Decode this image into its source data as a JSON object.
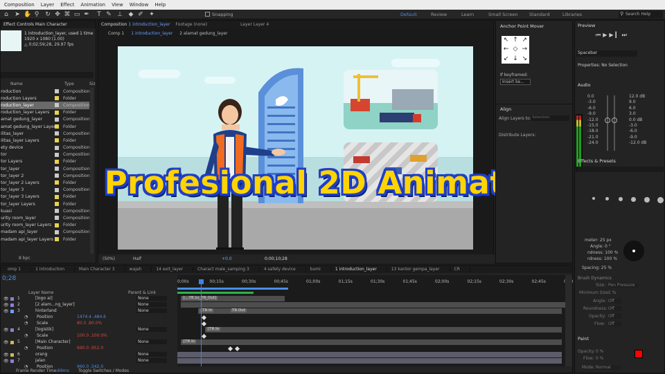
{
  "menu": [
    "Composition",
    "Layer",
    "Effect",
    "Animation",
    "View",
    "Window",
    "Help"
  ],
  "toolbar": {
    "snapping": "Snapping",
    "workspaces": [
      "Default",
      "Review",
      "Learn",
      "Small Screen",
      "Standard",
      "Libraries"
    ],
    "search": "Search Help"
  },
  "effect_controls": {
    "tab": "Effect Controls Main Character"
  },
  "project": {
    "comp_name": "1 introduction_layer",
    "used": ", used 1 time",
    "size": "1920 x 1080 (1.00)",
    "duration": "△ 0;02;59;28, 29.97 fps",
    "col_name": "Name",
    "col_type": "Type",
    "col_size": "Siz",
    "items": [
      {
        "name": "roduction",
        "type": "Composition",
        "color": "#c9c9c9"
      },
      {
        "name": "roduction Layers",
        "type": "Folder",
        "color": "#e8d24d"
      },
      {
        "name": "roduction_layer",
        "type": "Composition",
        "color": "#c9c9c9"
      },
      {
        "name": "roduction_layer Layers",
        "type": "Folder",
        "color": "#e8d24d"
      },
      {
        "name": "amat gedung_layer",
        "type": "Composition",
        "color": "#c9c9c9"
      },
      {
        "name": "amat gedung_layer Layers",
        "type": "Folder",
        "color": "#e8d24d"
      },
      {
        "name": "ilitas_layer",
        "type": "Composition",
        "color": "#c9c9c9"
      },
      {
        "name": "ilitas_layer Layers",
        "type": "Folder",
        "color": "#e8d24d"
      },
      {
        "name": "ety device",
        "type": "Composition",
        "color": "#c9c9c9"
      },
      {
        "name": "tor",
        "type": "Composition",
        "color": "#c9c9c9"
      },
      {
        "name": "tor Layers",
        "type": "Folder",
        "color": "#e8d24d"
      },
      {
        "name": "tor_layer",
        "type": "Composition",
        "color": "#c9c9c9"
      },
      {
        "name": "tor_layer 2",
        "type": "Composition",
        "color": "#c9c9c9"
      },
      {
        "name": "tor_layer 2 Layers",
        "type": "Folder",
        "color": "#e8d24d"
      },
      {
        "name": "tor_layer 3",
        "type": "Composition",
        "color": "#c9c9c9"
      },
      {
        "name": "tor_layer 3 Layers",
        "type": "Folder",
        "color": "#e8d24d"
      },
      {
        "name": "tor_layer Layers",
        "type": "Folder",
        "color": "#e8d24d"
      },
      {
        "name": "kuasi",
        "type": "Composition",
        "color": "#c9c9c9"
      },
      {
        "name": "urity room_layer",
        "type": "Composition",
        "color": "#c9c9c9"
      },
      {
        "name": "urity room_layer Layers",
        "type": "Folder",
        "color": "#e8d24d"
      },
      {
        "name": "madam api_layer",
        "type": "Composition",
        "color": "#c9c9c9"
      },
      {
        "name": "madam api_layer Layers",
        "type": "Folder",
        "color": "#e8d24d"
      }
    ],
    "bpc": "8 bpc"
  },
  "composition": {
    "tab_label": "Composition",
    "tab_name": "1 introduction_layer",
    "footage": "Footage (none)",
    "layer": "Layer Layer 4",
    "breadcrumbs": [
      "Comp 1",
      "1 introduction_layer",
      "2 alamat gedung_layer"
    ],
    "zoom": "(50%)",
    "resolution": "Half",
    "exposure": "+0.0",
    "timecode": "0;00;10;28"
  },
  "anchor_panel": {
    "title": "Anchor Point Mover",
    "if_keyframed": "If keyframed:",
    "insert": "Insert ke..."
  },
  "align_panel": {
    "title": "Align",
    "align_to": "Align Layers to:",
    "selection": "Selection",
    "distribute": "Distribute Layers:"
  },
  "preview": {
    "title": "Preview",
    "shortcut": "Spacebar",
    "properties": "Properties: No Selection"
  },
  "audio": {
    "title": "Audio",
    "left": [
      "0.0",
      "-3.0",
      "-6.0",
      "-9.0",
      "-12.0",
      "-15.0",
      "-18.0",
      "-21.0",
      "-24.0"
    ],
    "right": [
      "12.0 dB",
      "9.0",
      "6.0",
      "3.0",
      "0.0 dB",
      "-3.0",
      "-6.0",
      "-9.0",
      "-12.0 dB"
    ]
  },
  "effects": {
    "title": "Effects & Presets"
  },
  "brush": {
    "diameter": "meter: 25 px",
    "angle": "Angle: 0 °",
    "roundness": "ndness: 100 %",
    "hardness": "rdness: 100 %",
    "spacing": "Spacing: 25 %",
    "dynamics": "Brush Dynamics",
    "size": "Size:",
    "pressure": "Pen Pressure",
    "min_size": "Minimum Size:",
    "min_val": "1 %",
    "angle2": "Angle:",
    "roundness2": "Roundness:",
    "opacity": "Opacity:",
    "flow": "Flow:",
    "off": "Off"
  },
  "paint": {
    "title": "Paint",
    "opacity": "Opacity:",
    "opacity_val": "0 %",
    "flow": "Flow:",
    "flow_val": "0 %",
    "mode": "Mode:",
    "mode_val": "Normal",
    "fg": "#ff0000",
    "bg": "#ffffff"
  },
  "overlay_title": "Profesional 2D Animation",
  "timeline": {
    "tabs": [
      "omp 1",
      "1 introduction",
      "Main Character 3",
      "wajah",
      "14 exit_layer",
      "Charact male_samping 3",
      "4 safety device",
      "bumi",
      "1 introduction_layer",
      "13 kantor gempa_layer",
      "CR"
    ],
    "timecode": "0;28",
    "ruler": [
      "0;00s",
      "00;15s",
      "00;30s",
      "00;45s",
      "01;00s",
      "01;15s",
      "01;30s",
      "01;45s",
      "02;00s",
      "02;15s",
      "02;30s",
      "02;45s",
      "03;0"
    ],
    "col_layer": "Layer Name",
    "col_parent": "Parent & Link",
    "rows": [
      {
        "num": "1",
        "name": "[logo ai]",
        "parent": "None",
        "kind": "layer"
      },
      {
        "num": "2",
        "name": "[2 alam...ng_layer]",
        "parent": "None",
        "kind": "layer"
      },
      {
        "num": "3",
        "name": "hinterland",
        "parent": "None",
        "kind": "layer"
      },
      {
        "num": "",
        "name": "Position",
        "value": "1474.4 ,484.6",
        "kind": "prop"
      },
      {
        "num": "",
        "name": "Scale",
        "value": "80.0 ,80.0%",
        "kind": "prop"
      },
      {
        "num": "4",
        "name": "[logistik]",
        "parent": "None",
        "kind": "layer"
      },
      {
        "num": "",
        "name": "Scale",
        "value": "100.0 ,100.0%",
        "kind": "prop"
      },
      {
        "num": "5",
        "name": "[Main Character]",
        "parent": "None",
        "kind": "layer"
      },
      {
        "num": "",
        "name": "Position",
        "value": "690.0 ,952.0",
        "kind": "prop"
      },
      {
        "num": "6",
        "name": "orang",
        "parent": "None",
        "kind": "layer"
      },
      {
        "num": "7",
        "name": "jalan",
        "parent": "None",
        "kind": "layer"
      },
      {
        "num": "",
        "name": "Position",
        "value": "960.0 ,542.0",
        "kind": "prop"
      }
    ],
    "bar_labels": [
      "[...78.1s_TR_Out]",
      "[TR In",
      "TR Out",
      "[TR In",
      "[TR In",
      "TR Out"
    ],
    "footer_left": "Frame Render Time:",
    "footer_ms": "69ms",
    "footer_right": "Toggle Switches / Modes"
  }
}
